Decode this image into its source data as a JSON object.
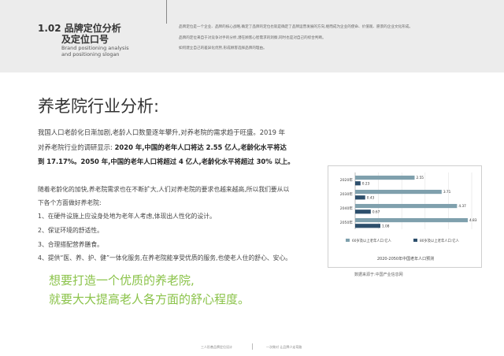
{
  "header": {
    "code_title": "1.02 品牌定位分析",
    "title_line2": "及定位口号",
    "subtitle_en_1": "Brand positioning analysis",
    "subtitle_en_2": "and positioning slogan",
    "desc": [
      "品牌定位是一个企业、品牌的核心战略,确定了品牌的定位也就是确定了品牌运营发展的方向,继而成为企业的使命、价值观、愿景的企业文化形成。",
      "品牌的定位来自于对竞争对手的分析,潜在顾客心智需求的洞察,同时也是对自己的综合判断。",
      "如何建立自己的差异化优势,形成顾客选择品牌的理由。"
    ]
  },
  "section": {
    "title": "养老院行业分析:"
  },
  "paragraph1": {
    "line1": "我国人口老龄化日渐加剧,老龄人口数量逐年攀升,对养老院的需求趋于旺盛。2019 年",
    "line2_normal": "对养老院行业的调研显示: ",
    "line2_bold": "2020 年,中国的老年人口将达 2.55 亿人,老龄化水平将达",
    "line3_bold": "到 17.17%。2050 年,中国的老年人口将超过 4 亿人,老龄化水平将超过 30% 以上。"
  },
  "paragraph2": {
    "lines": [
      "随着老龄化的加快,养老院需求也在不断扩大,人们对养老院的要求也越来越高,所以我们要从以",
      "下各个方面做好养老院:",
      "1、在硬件设施上应设身处地为老年人考虑,体现出人性化的设计。",
      "2、保证环境的舒适性。",
      "3、合理搭配营养膳食。",
      "4、提供“医、养、护、健”一体化服务,在养老院能享受优质的服务,也使老人住的舒心、安心。"
    ]
  },
  "slogan": {
    "line1": "想要打造一个优质的养老院,",
    "line2": "就要大大提高老人各方面的舒心程度。"
  },
  "chart_data": {
    "type": "bar",
    "orientation": "horizontal",
    "title": "2020-2050年中国老年人口预测",
    "categories": [
      "2020年",
      "2030年",
      "2040年",
      "2050年"
    ],
    "series": [
      {
        "name": "60岁及以上老年人口:亿人",
        "values": [
          2.55,
          3.71,
          4.37,
          4.83
        ],
        "color": "#7fa0ad"
      },
      {
        "name": "80岁及以上老年人口:亿人",
        "values": [
          0.23,
          0.43,
          0.67,
          1.08
        ],
        "color": "#2d4f6c"
      }
    ],
    "xlim": [
      0,
      5
    ],
    "grid": true,
    "legend_position": "bottom",
    "source": "数据来源于:中国产业信息网"
  },
  "footer": {
    "left": "三人形善品牌定位设计",
    "right": "一次做对 让品牌少走弯路"
  }
}
